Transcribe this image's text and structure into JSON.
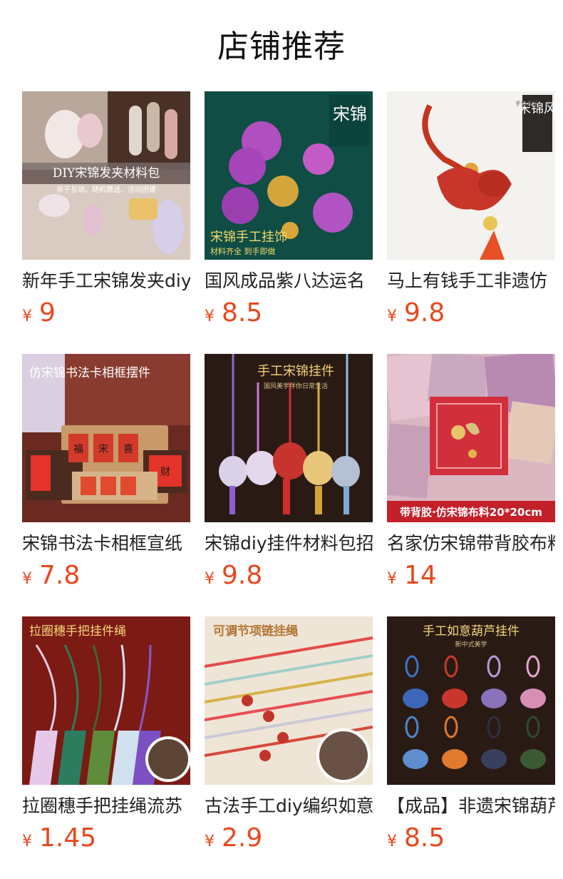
{
  "section": {
    "title": "店铺推荐"
  },
  "currency": "¥",
  "products": [
    {
      "name": "新年手工宋锦发夹diy",
      "price": "9",
      "image_text": {
        "banner": "DIY宋锦发夹材料包",
        "sub": "亲子互动、随机赠送、活动团建"
      }
    },
    {
      "name": "国风成品紫八达运名",
      "price": "8.5",
      "image_text": {
        "corner": "宋锦",
        "banner": "宋锦手工挂饰",
        "sub": "材料齐全 到手即做"
      }
    },
    {
      "name": "马上有钱手工非遗仿",
      "price": "9.8",
      "image_text": {
        "corner": "宋锦风",
        "side": "手安喜乐"
      }
    },
    {
      "name": "宋锦书法卡相框宣纸",
      "price": "7.8",
      "image_text": {
        "banner": "仿宋锦书法卡相框摆件",
        "card1": "福",
        "card2": "宋",
        "card3": "喜",
        "card4": "财"
      }
    },
    {
      "name": "宋锦diy挂件材料包招",
      "price": "9.8",
      "image_text": {
        "banner": "手工宋锦挂件",
        "sub": "国风美学伴你日常生活"
      }
    },
    {
      "name": "名家仿宋锦带背胶布料",
      "price": "14",
      "image_text": {
        "banner": "带背胶·仿宋锦布料20*20cm"
      }
    },
    {
      "name": "拉圈穗手把挂绳流苏",
      "price": "1.45",
      "image_text": {
        "banner": "拉圈穗手把挂件绳"
      }
    },
    {
      "name": "古法手工diy编织如意",
      "price": "2.9",
      "image_text": {
        "banner": "可调节项链挂绳"
      }
    },
    {
      "name": "【成品】非遗宋锦葫芦",
      "price": "8.5",
      "image_text": {
        "banner": "手工如意葫芦挂件",
        "sub": "新中式美学"
      }
    }
  ]
}
